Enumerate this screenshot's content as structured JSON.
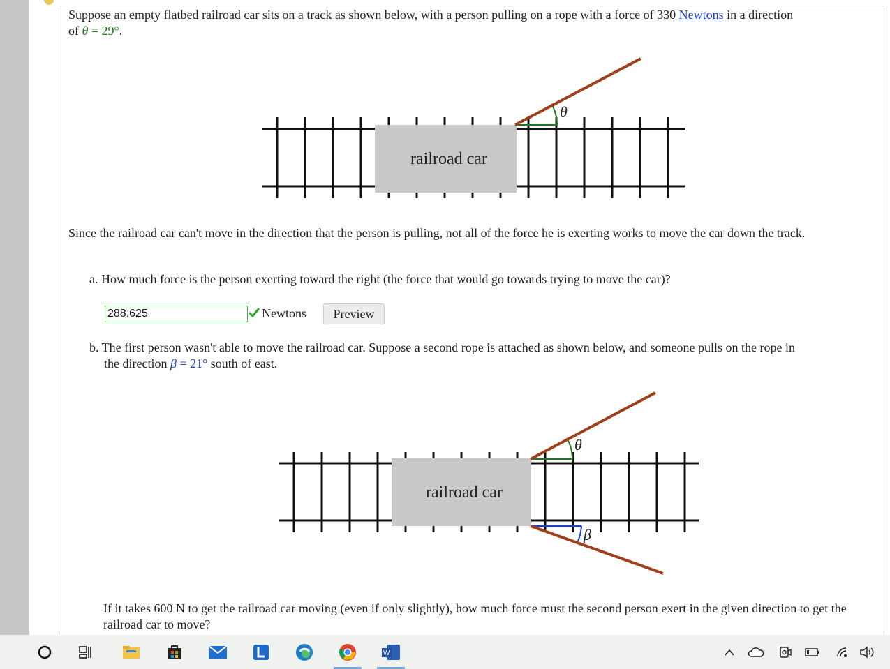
{
  "problem": {
    "intro_part1": "Suppose an empty flatbed railroad car sits on a track as shown below, with a person pulling on a rope with a force of 330 ",
    "newtons_link": "Newtons",
    "intro_part2": " in a direction",
    "intro_line2_prefix": "of ",
    "theta_symbol": "θ",
    "equals": " = ",
    "theta_value": "29°",
    "intro_line2_suffix": ".",
    "since_text": "Since the railroad car can't move in the direction that the person is pulling, not all of the force he is exerting works to move the car down the track."
  },
  "diagram": {
    "car_label": "railroad car",
    "theta_label": "θ",
    "beta_label": "β"
  },
  "question_a": {
    "text": "a. How much force is the person exerting toward the right (the force that would go towards trying to move the car)?",
    "answer_value": "288.625",
    "unit": "Newtons",
    "preview_label": "Preview"
  },
  "question_b": {
    "text_before": "b. The first person wasn't able to move the railroad car. Suppose a second rope is attached as shown below, and someone pulls on the rope in",
    "line2_prefix": "the direction ",
    "beta_symbol": "β",
    "equals": " = ",
    "beta_value": "21°",
    "line2_suffix": " south of east.",
    "followup": "If it takes 600 N to get the railroad car moving (even if only slightly), how much force must the second person exert in the given direction to get the railroad car to move?"
  },
  "colors": {
    "rope": "#a0401a",
    "theta_marker": "#1b7a1b",
    "beta_marker": "#1e3fc8",
    "car": "#c8c8c8",
    "answer_border": "#3cba3c"
  },
  "taskbar": {
    "items": [
      "start-icon",
      "task-view-icon",
      "file-explorer-icon",
      "store-icon",
      "mail-icon",
      "lexia-icon",
      "edge-icon",
      "chrome-icon",
      "word-icon"
    ],
    "tray": [
      "chevron-up-icon",
      "onedrive-icon",
      "meet-now-icon",
      "battery-icon",
      "wifi-icon",
      "volume-icon"
    ]
  }
}
